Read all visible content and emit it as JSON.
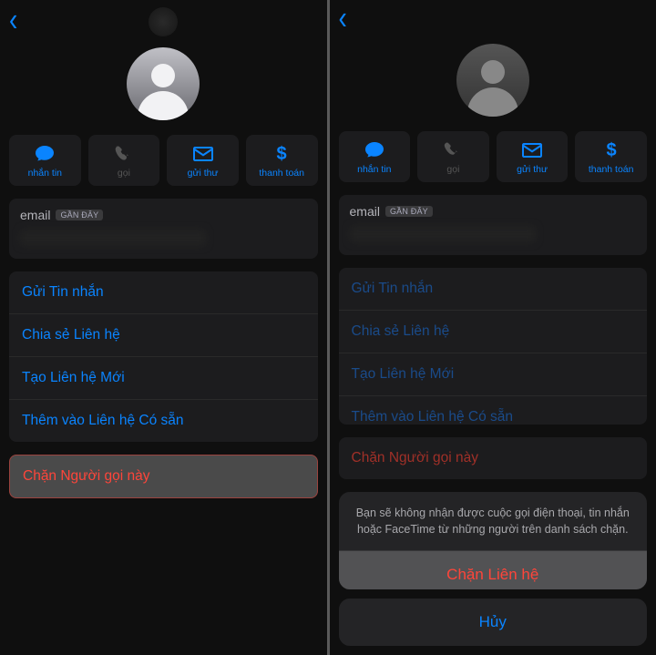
{
  "nav": {
    "back": "‹"
  },
  "actions": {
    "message": "nhắn tin",
    "call": "gọi",
    "mail": "gửi thư",
    "pay": "thanh toán"
  },
  "email": {
    "label": "email",
    "badge": "GẦN ĐÂY"
  },
  "options": {
    "sendMessage": "Gửi Tin nhắn",
    "shareContact": "Chia sẻ Liên hệ",
    "createNew": "Tạo Liên hệ Mới",
    "addExisting": "Thêm vào Liên hệ Có sẵn"
  },
  "block": {
    "caller": "Chặn Người gọi này"
  },
  "sheet": {
    "message": "Bạn sẽ không nhận được cuộc gọi điện thoại, tin nhắn hoặc FaceTime từ những người trên danh sách chặn.",
    "confirm": "Chặn Liên hệ",
    "cancel": "Hủy"
  }
}
